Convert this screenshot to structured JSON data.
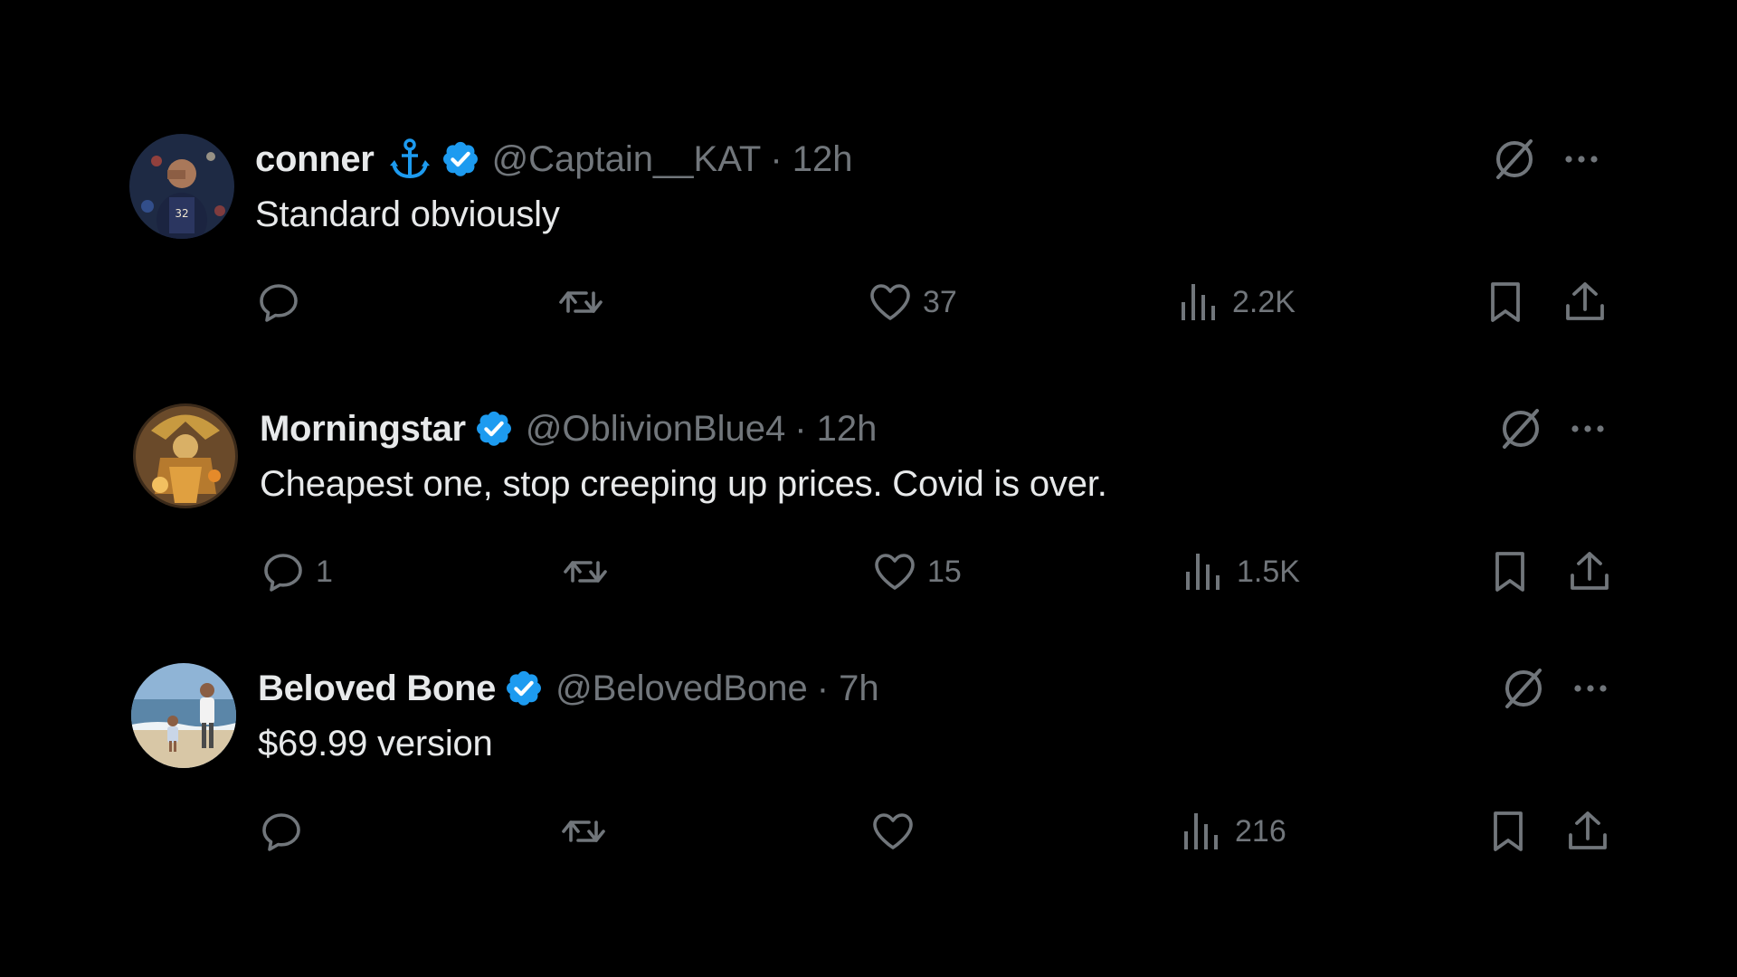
{
  "colors": {
    "background": "#000000",
    "text": "#e7e9ea",
    "muted": "#71767b",
    "verified": "#1d9bf0"
  },
  "tweets": [
    {
      "name": "conner",
      "name_emoji": "⚓",
      "handle": "@Captain__KAT",
      "time": "· 12h",
      "text": "Standard obviously",
      "replies": "",
      "reposts": "",
      "likes": "37",
      "views": "2.2K"
    },
    {
      "name": "Morningstar",
      "handle": "@OblivionBlue4",
      "time": "· 12h",
      "text": "Cheapest one, stop creeping up prices. Covid is over.",
      "replies": "1",
      "reposts": "",
      "likes": "15",
      "views": "1.5K"
    },
    {
      "name": "Beloved Bone",
      "handle": "@BelovedBone",
      "time": "· 7h",
      "text": "$69.99 version",
      "replies": "",
      "reposts": "",
      "likes": "",
      "views": "216"
    }
  ]
}
